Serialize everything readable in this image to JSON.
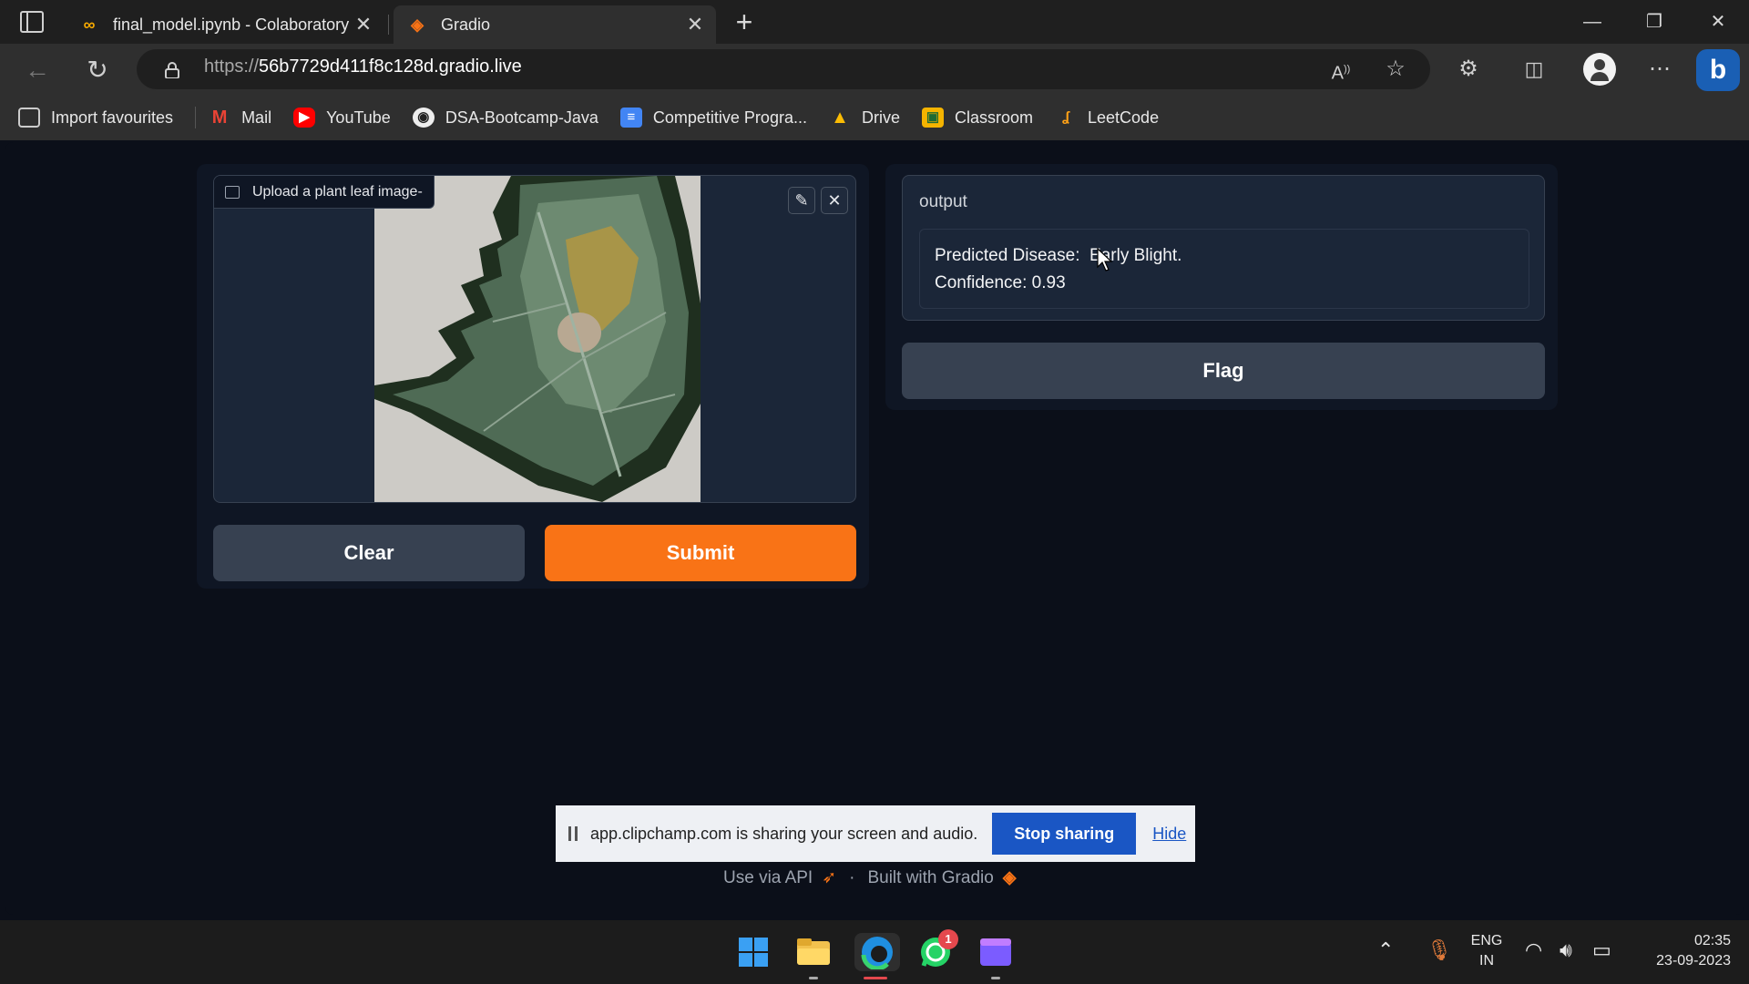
{
  "browser": {
    "tabs": [
      {
        "title": "final_model.ipynb - Colaboratory",
        "favicon": "colab-icon"
      },
      {
        "title": "Gradio",
        "favicon": "gradio-icon"
      }
    ],
    "url_scheme": "https://",
    "url_host": "56b7729d411f8c128d.gradio.live",
    "bookmarks": [
      {
        "label": "Import favourites",
        "icon": "import-icon"
      },
      {
        "label": "Mail",
        "icon": "gmail-icon"
      },
      {
        "label": "YouTube",
        "icon": "youtube-icon"
      },
      {
        "label": "DSA-Bootcamp-Java",
        "icon": "github-icon"
      },
      {
        "label": "Competitive Progra...",
        "icon": "docs-icon"
      },
      {
        "label": "Drive",
        "icon": "drive-icon"
      },
      {
        "label": "Classroom",
        "icon": "classroom-icon"
      },
      {
        "label": "LeetCode",
        "icon": "leetcode-icon"
      }
    ]
  },
  "app": {
    "input": {
      "label": "Upload a plant leaf image-"
    },
    "buttons": {
      "clear": "Clear",
      "submit": "Submit",
      "flag": "Flag"
    },
    "output": {
      "label": "output",
      "line1": "Predicted Disease:  Early Blight.",
      "line2": "Confidence: 0.93"
    },
    "footer": {
      "api": "Use via API",
      "sep": "·",
      "built": "Built with Gradio"
    }
  },
  "sharing": {
    "message": "app.clipchamp.com is sharing your screen and audio.",
    "stop": "Stop sharing",
    "hide": "Hide"
  },
  "taskbar": {
    "whatsapp_badge": "1",
    "lang": "ENG",
    "region": "IN",
    "time": "02:35",
    "date": "23-09-2023"
  },
  "colors": {
    "accent": "#f97316",
    "background": "#0b0f19",
    "panel": "#0f1624",
    "secondary_button": "#374151"
  }
}
